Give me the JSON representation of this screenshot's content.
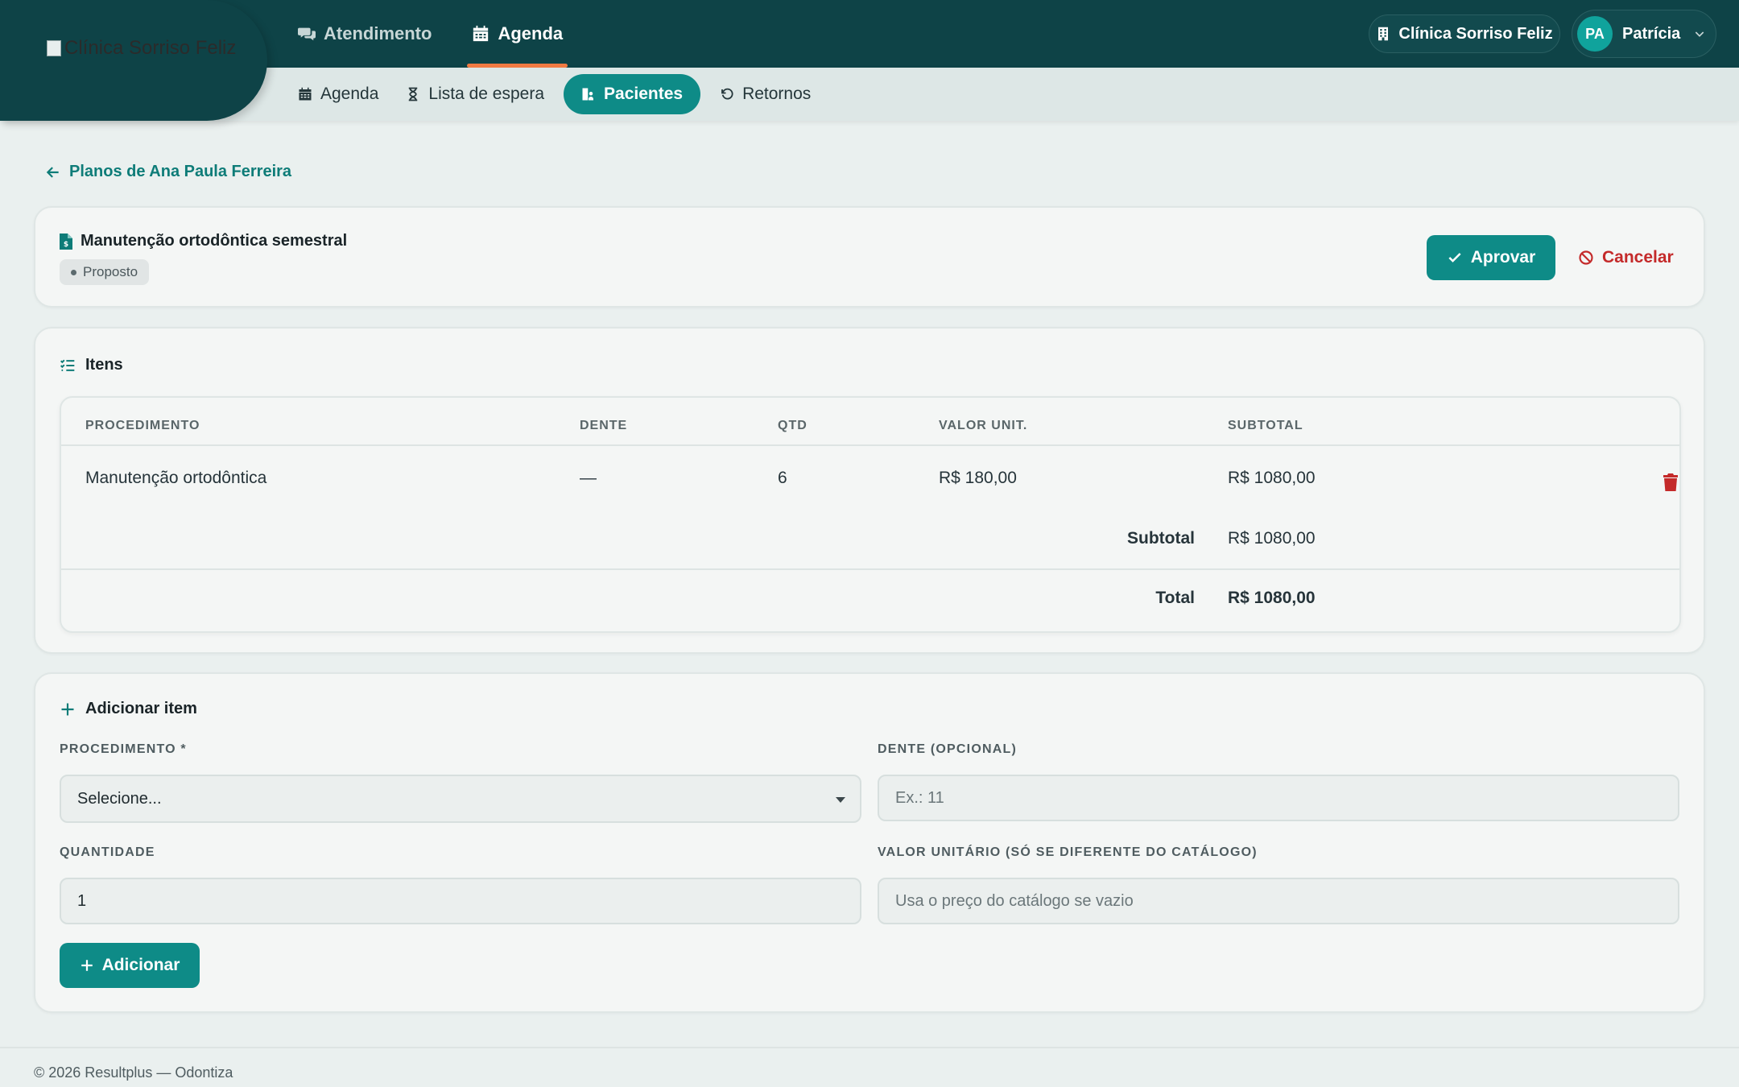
{
  "header": {
    "logo_alt": "Clínica Sorriso Feliz",
    "nav": [
      {
        "label": "Atendimento",
        "icon": "chat-icon",
        "active": false
      },
      {
        "label": "Agenda",
        "icon": "calendar-icon",
        "active": true
      }
    ],
    "subnav": [
      {
        "label": "Agenda",
        "icon": "calendar-icon",
        "active": false
      },
      {
        "label": "Lista de espera",
        "icon": "hourglass-icon",
        "active": false
      },
      {
        "label": "Pacientes",
        "icon": "patients-icon",
        "active": true
      },
      {
        "label": "Retornos",
        "icon": "undo-icon",
        "active": false
      }
    ],
    "clinic": "Clínica Sorriso Feliz",
    "user": {
      "initials": "PA",
      "name": "Patrícia"
    }
  },
  "back_link": "Planos de Ana Paula Ferreira",
  "plan": {
    "title": "Manutenção ortodôntica semestral",
    "status": "Proposto",
    "approve_label": "Aprovar",
    "cancel_label": "Cancelar"
  },
  "items": {
    "title": "Itens",
    "columns": [
      "PROCEDIMENTO",
      "DENTE",
      "QTD",
      "VALOR UNIT.",
      "SUBTOTAL"
    ],
    "rows": [
      {
        "procedure": "Manutenção ortodôntica",
        "tooth": "—",
        "qty": "6",
        "unit": "R$ 180,00",
        "subtotal": "R$ 1080,00"
      }
    ],
    "subtotal_label": "Subtotal",
    "subtotal_value": "R$ 1080,00",
    "total_label": "Total",
    "total_value": "R$ 1080,00"
  },
  "add_item": {
    "title": "Adicionar item",
    "procedure_label": "PROCEDIMENTO *",
    "procedure_value": "Selecione...",
    "tooth_label": "DENTE (OPCIONAL)",
    "tooth_placeholder": "Ex.: 11",
    "qty_label": "QUANTIDADE",
    "qty_value": "1",
    "unit_label": "VALOR UNITÁRIO (SÓ SE DIFERENTE DO CATÁLOGO)",
    "unit_placeholder": "Usa o preço do catálogo se vazio",
    "button_label": "Adicionar"
  },
  "footer": "© 2026 Resultplus — Odontiza",
  "colors": {
    "primary": "#0e8b87",
    "header": "#0e4347",
    "accent": "#f07a42",
    "danger": "#c42a2a"
  }
}
